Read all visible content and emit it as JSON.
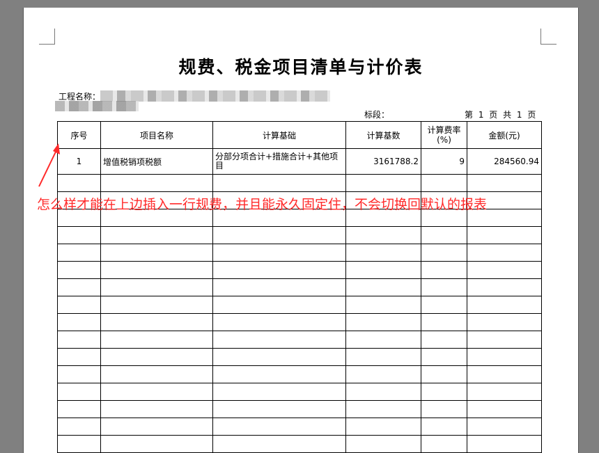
{
  "document": {
    "title": "规费、税金项目清单与计价表",
    "project_label": "工程名称：",
    "section_label": "标段：",
    "page_info": "第 1 页   共 1 页"
  },
  "table": {
    "headers": [
      "序号",
      "项目名称",
      "计算基础",
      "计算基数",
      "计算费率(%)",
      "金额(元)"
    ],
    "rows": [
      [
        "1",
        "增值税销项税额",
        "分部分项合计+措施合计+其他项目",
        "3161788.2",
        "9",
        "284560.94"
      ]
    ],
    "empty_rows": 16
  },
  "annotation": {
    "text": "怎么样才能在上边插入一行规费，并且能永久固定住，不会切换回默认的报表",
    "color": "#ff2a2a"
  }
}
